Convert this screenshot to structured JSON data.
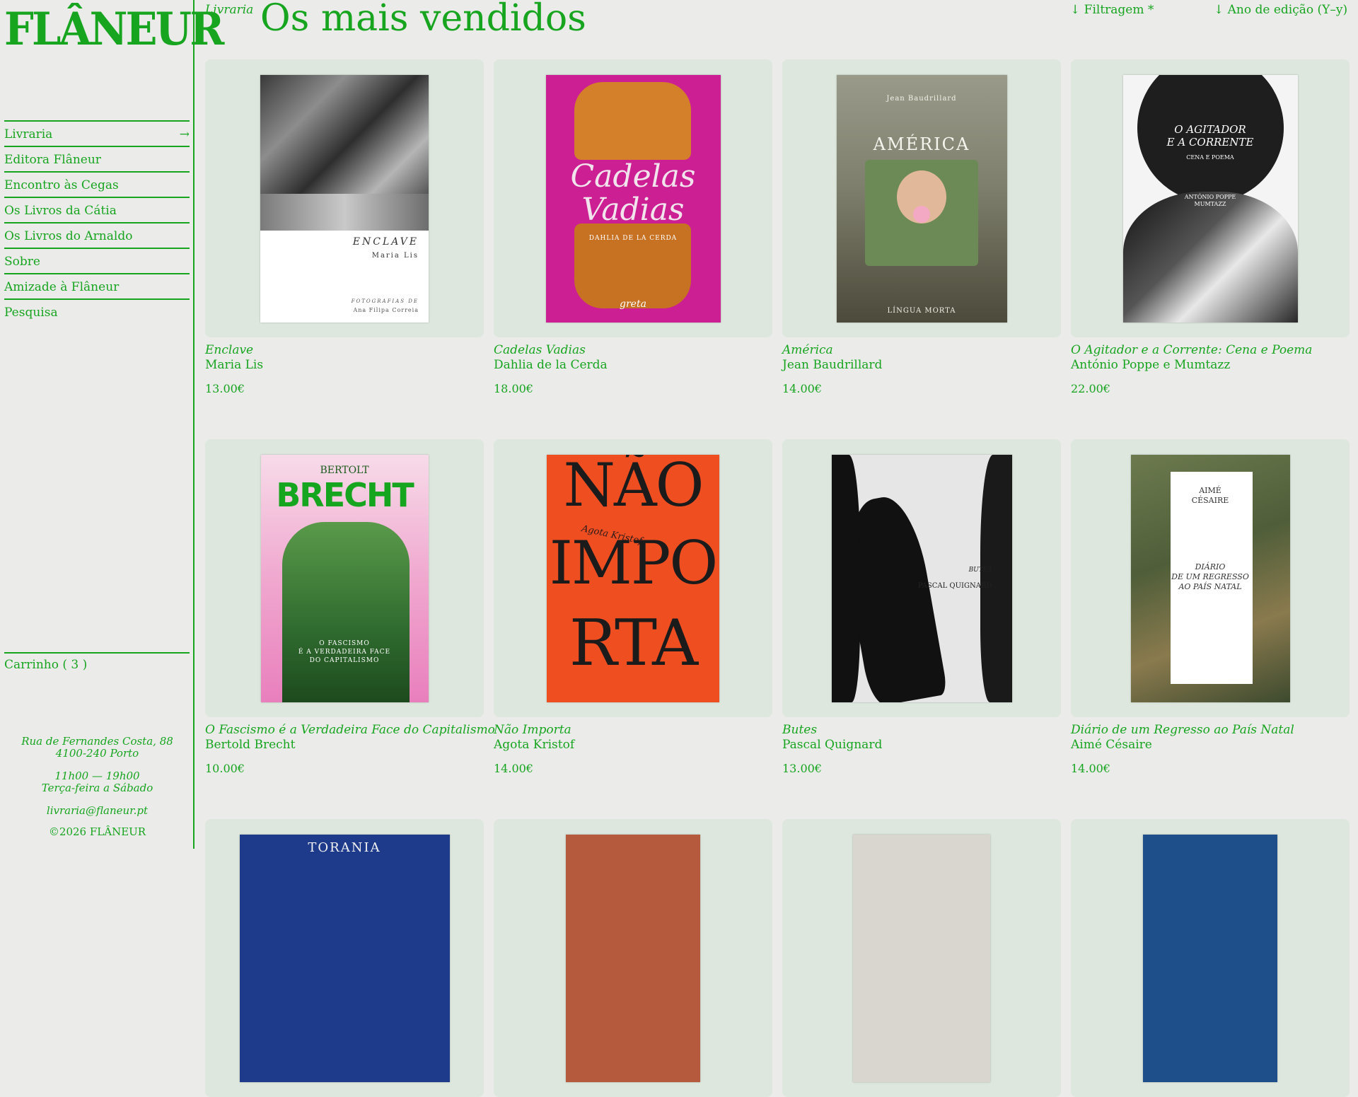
{
  "brand": {
    "logo": "FLÂNEUR"
  },
  "nav": {
    "items": [
      {
        "label": "Livraria",
        "arrow": "→"
      },
      {
        "label": "Editora Flâneur",
        "arrow": ""
      },
      {
        "label": "Encontro às Cegas",
        "arrow": ""
      },
      {
        "label": "Os Livros da Cátia",
        "arrow": ""
      },
      {
        "label": "Os Livros do Arnaldo",
        "arrow": ""
      },
      {
        "label": "Sobre",
        "arrow": ""
      },
      {
        "label": "Amizade à Flâneur",
        "arrow": ""
      },
      {
        "label": "Pesquisa",
        "arrow": ""
      }
    ]
  },
  "cart": {
    "label": "Carrinho ( 3 )"
  },
  "footer": {
    "address_line1": "Rua de Fernandes Costa, 88",
    "address_line2": "4100-240 Porto",
    "hours_line1": "11h00 — 19h00",
    "hours_line2": "Terça-feira a Sábado",
    "email": "livraria@flaneur.pt",
    "copyright": "©2026 FLÂNEUR"
  },
  "header": {
    "breadcrumb": "Livraria",
    "title": "Os mais vendidos",
    "filter_label": "↓ Filtragem *",
    "sort_label": "↓ Ano de edição (Y–y)"
  },
  "books": [
    {
      "title": "Enclave",
      "author": "Maria Lis",
      "price": "13.00€",
      "cover": {
        "line1": "ENCLAVE",
        "line2": "Maria Lis",
        "line3": "FOTOGRAFIAS DE",
        "line4": "Ana Filipa Correia"
      }
    },
    {
      "title": "Cadelas Vadias",
      "author": "Dahlia de la Cerda",
      "price": "18.00€",
      "cover": {
        "line1": "Cadelas",
        "line2": "Vadias",
        "line3": "DAHLIA DE LA CERDA",
        "line4": "greta"
      }
    },
    {
      "title": "América",
      "author": "Jean Baudrillard",
      "price": "14.00€",
      "cover": {
        "line1": "Jean Baudrillard",
        "line2": "AMÉRICA",
        "line3": "LÍNGUA MORTA"
      }
    },
    {
      "title": "O Agitador e a Corrente: Cena e Poema",
      "author": "António Poppe e Mumtazz",
      "price": "22.00€",
      "cover": {
        "line1": "O AGITADOR",
        "line2": "E A CORRENTE",
        "line3": "CENA E POEMA",
        "line4": "ANTÓNIO POPPE",
        "line5": "MUMTAZZ"
      }
    },
    {
      "title": "O Fascismo é a Verdadeira Face do Capitalismo",
      "author": "Bertold Brecht",
      "price": "10.00€",
      "cover": {
        "line1": "BERTOLT",
        "line2": "BRECHT",
        "line3": "O FASCISMO",
        "line4": "É A VERDADEIRA FACE",
        "line5": "DO CAPITALISMO"
      }
    },
    {
      "title": "Não Importa",
      "author": "Agota Kristof",
      "price": "14.00€",
      "cover": {
        "line1": "NÃO",
        "line2": "IMPO",
        "line3": "RTA",
        "line4": "Agota Kristof"
      }
    },
    {
      "title": "Butes",
      "author": "Pascal Quignard",
      "price": "13.00€",
      "cover": {
        "line1": "BUTES",
        "line2": "PASCAL QUIGNARD"
      }
    },
    {
      "title": "Diário de um Regresso ao País Natal",
      "author": "Aimé Césaire",
      "price": "14.00€",
      "cover": {
        "line1": "AIMÉ",
        "line2": "CÉSAIRE",
        "line3": "DIÁRIO",
        "line4": "DE UM REGRESSO",
        "line5": "AO PAÍS NATAL"
      }
    }
  ],
  "partial_row": {
    "cover_text": "TORANIA"
  },
  "colors": {
    "accent": "#17a51f",
    "background": "#ebebea",
    "card": "#dde7dd"
  }
}
